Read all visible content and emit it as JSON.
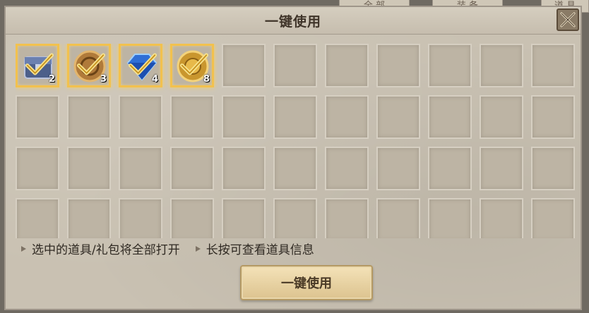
{
  "background_tabs": [
    "全 部",
    "装 备",
    "道 具"
  ],
  "title": "一键使用",
  "items": [
    {
      "icon": "chest-icon",
      "count": "2",
      "selected": true
    },
    {
      "icon": "bronze-coin-icon",
      "count": "3",
      "selected": true
    },
    {
      "icon": "blue-diamond-icon",
      "count": "4",
      "selected": true
    },
    {
      "icon": "gold-coin-icon",
      "count": "8",
      "selected": true
    }
  ],
  "notes": {
    "note1": "选中的道具/礼包将全部打开",
    "note2": "长按可查看道具信息"
  },
  "use_button": "一键使用",
  "colors": {
    "selected_border": "#f2c14e",
    "panel_bg": "#c9c1b2"
  }
}
